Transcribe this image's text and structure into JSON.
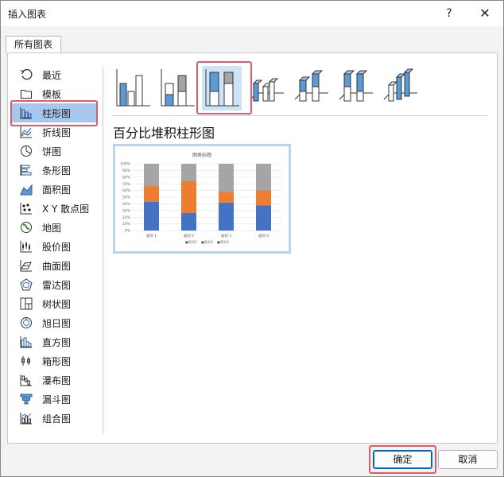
{
  "window": {
    "title": "插入图表",
    "help": "?",
    "close": "✕"
  },
  "tabs": [
    {
      "label": "所有图表"
    }
  ],
  "sidebar": {
    "items": [
      {
        "label": "最近",
        "icon": "recent-icon"
      },
      {
        "label": "模板",
        "icon": "folder-icon"
      },
      {
        "label": "柱形图",
        "icon": "column-chart-icon",
        "selected": true
      },
      {
        "label": "折线图",
        "icon": "line-chart-icon"
      },
      {
        "label": "饼图",
        "icon": "pie-chart-icon"
      },
      {
        "label": "条形图",
        "icon": "bar-chart-icon"
      },
      {
        "label": "面积图",
        "icon": "area-chart-icon"
      },
      {
        "label": "X Y 散点图",
        "icon": "scatter-chart-icon"
      },
      {
        "label": "地图",
        "icon": "map-chart-icon"
      },
      {
        "label": "股价图",
        "icon": "stock-chart-icon"
      },
      {
        "label": "曲面图",
        "icon": "surface-chart-icon"
      },
      {
        "label": "雷达图",
        "icon": "radar-chart-icon"
      },
      {
        "label": "树状图",
        "icon": "treemap-chart-icon"
      },
      {
        "label": "旭日图",
        "icon": "sunburst-chart-icon"
      },
      {
        "label": "直方图",
        "icon": "histogram-chart-icon"
      },
      {
        "label": "箱形图",
        "icon": "box-whisker-icon"
      },
      {
        "label": "瀑布图",
        "icon": "waterfall-chart-icon"
      },
      {
        "label": "漏斗图",
        "icon": "funnel-chart-icon"
      },
      {
        "label": "组合图",
        "icon": "combo-chart-icon"
      }
    ]
  },
  "subtypes": {
    "selected_index": 2,
    "items": [
      {
        "icon": "clustered-column-icon"
      },
      {
        "icon": "stacked-column-icon"
      },
      {
        "icon": "percent-stacked-column-icon"
      },
      {
        "icon": "3d-clustered-column-icon"
      },
      {
        "icon": "3d-stacked-column-icon"
      },
      {
        "icon": "3d-percent-stacked-column-icon"
      },
      {
        "icon": "3d-column-icon"
      }
    ]
  },
  "selected_chart_name": "百分比堆积柱形图",
  "preview": {
    "title": "图表标题",
    "categories": [
      "类别 1",
      "类别 2",
      "类别 3",
      "类别 4"
    ],
    "y_ticks": [
      "100%",
      "90%",
      "80%",
      "70%",
      "60%",
      "50%",
      "40%",
      "30%",
      "20%",
      "10%",
      "0%"
    ],
    "legend": [
      "■系列1",
      "■系列2",
      "■系列3"
    ],
    "series": [
      {
        "name": "系列1",
        "color": "#4472c4",
        "values": [
          43.3,
          26.2,
          41.8,
          37.5
        ]
      },
      {
        "name": "系列2",
        "color": "#ed7d31",
        "values": [
          23.3,
          47.6,
          16.4,
          22.7
        ]
      },
      {
        "name": "系列3",
        "color": "#a5a5a5",
        "values": [
          33.4,
          26.2,
          41.8,
          39.8
        ]
      }
    ]
  },
  "buttons": {
    "ok": "确定",
    "cancel": "取消"
  },
  "colors": {
    "accent": "#0067c0",
    "selection": "#a6c8ec",
    "highlight": "#e15a66"
  }
}
